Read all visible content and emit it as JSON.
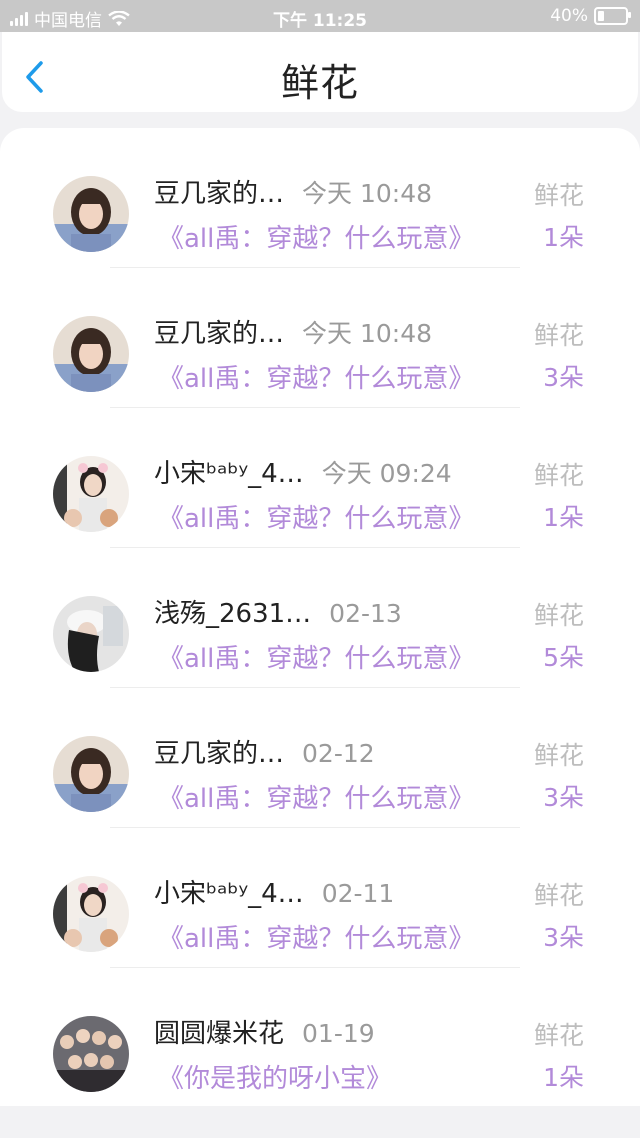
{
  "status_bar": {
    "carrier": "中国电信",
    "time": "下午 11:25",
    "battery_percent": "40%",
    "battery_level": 0.4
  },
  "header": {
    "title": "鲜花",
    "back_icon": "chevron-left-icon"
  },
  "gift_label": "鲜花",
  "records": [
    {
      "name": "豆几家的…",
      "time": "今天 10:48",
      "book": "《all禹：穿越？什么玩意》",
      "count": "1朵",
      "avatar": "girl-avatar"
    },
    {
      "name": "豆几家的…",
      "time": "今天 10:48",
      "book": "《all禹：穿越？什么玩意》",
      "count": "3朵",
      "avatar": "girl-avatar"
    },
    {
      "name": "小宋ᵇᵃᵇʸ_4…",
      "time": "今天 09:24",
      "book": "《all禹：穿越？什么玩意》",
      "count": "1朵",
      "avatar": "boy-avatar"
    },
    {
      "name": "浅殇_2631…",
      "time": "02-13",
      "book": "《all禹：穿越？什么玩意》",
      "count": "5朵",
      "avatar": "hat-avatar"
    },
    {
      "name": "豆几家的…",
      "time": "02-12",
      "book": "《all禹：穿越？什么玩意》",
      "count": "3朵",
      "avatar": "girl-avatar"
    },
    {
      "name": "小宋ᵇᵃᵇʸ_4…",
      "time": "02-11",
      "book": "《all禹：穿越？什么玩意》",
      "count": "3朵",
      "avatar": "boy-avatar"
    },
    {
      "name": "圆圆爆米花",
      "time": "01-19",
      "book": "《你是我的呀小宝》",
      "count": "1朵",
      "avatar": "group-avatar"
    }
  ],
  "colors": {
    "accent_purple": "#b28ad9",
    "back_blue": "#1e9bea",
    "muted_gray": "#9a9a9a"
  }
}
